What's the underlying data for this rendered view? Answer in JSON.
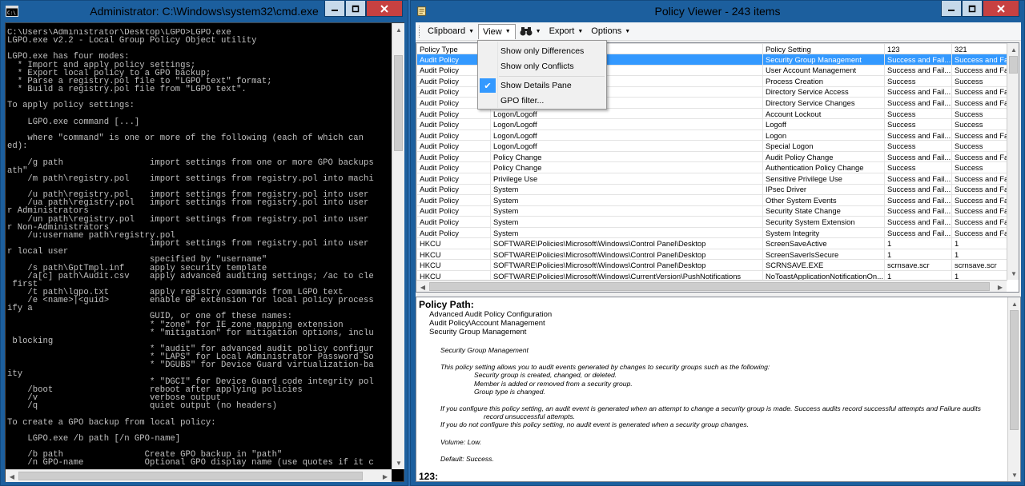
{
  "cmd": {
    "title": "Administrator: C:\\Windows\\system32\\cmd.exe",
    "lines": [
      "C:\\Users\\Administrator\\Desktop\\LGPO>LGPO.exe",
      "LGPO.exe v2.2 - Local Group Policy Object utility",
      "",
      "LGPO.exe has four modes:",
      "  * Import and apply policy settings;",
      "  * Export local policy to a GPO backup;",
      "  * Parse a registry.pol file to \"LGPO text\" format;",
      "  * Build a registry.pol file from \"LGPO text\".",
      "",
      "To apply policy settings:",
      "",
      "    LGPO.exe command [...]",
      "",
      "    where \"command\" is one or more of the following (each of which can",
      "ed):",
      "",
      "    /g path                 import settings from one or more GPO backups",
      "ath\"",
      "    /m path\\registry.pol    import settings from registry.pol into machi",
      "",
      "    /u path\\registry.pol    import settings from registry.pol into user",
      "    /ua path\\registry.pol   import settings from registry.pol into user",
      "r Administrators",
      "    /un path\\registry.pol   import settings from registry.pol into user",
      "r Non-Administrators",
      "    /u:username path\\registry.pol",
      "                            import settings from registry.pol into user",
      "r local user",
      "                            specified by \"username\"",
      "    /s path\\GptTmpl.inf     apply security template",
      "    /a[c] path\\Audit.csv    apply advanced auditing settings; /ac to cle",
      " first",
      "    /t path\\lgpo.txt        apply registry commands from LGPO text",
      "    /e <name>|<guid>        enable GP extension for local policy process",
      "ify a",
      "                            GUID, or one of these names:",
      "                            * \"zone\" for IE zone mapping extension",
      "                            * \"mitigation\" for mitigation options, inclu",
      " blocking",
      "                            * \"audit\" for advanced audit policy configur",
      "                            * \"LAPS\" for Local Administrator Password So",
      "                            * \"DGUBS\" for Device Guard virtualization-ba",
      "ity",
      "                            * \"DGCI\" for Device Guard code integrity pol",
      "    /boot                   reboot after applying policies",
      "    /v                      verbose output",
      "    /q                      quiet output (no headers)",
      "",
      "To create a GPO backup from local policy:",
      "",
      "    LGPO.exe /b path [/n GPO-name]",
      "",
      "    /b path                Create GPO backup in \"path\"",
      "    /n GPO-name            Optional GPO display name (use quotes if it c"
    ]
  },
  "pv": {
    "title": "Policy Viewer - 243 items",
    "toolbar": {
      "clipboard": "Clipboard",
      "view": "View",
      "export": "Export",
      "options": "Options"
    },
    "menu": {
      "items": [
        "Show only Differences",
        "Show only Conflicts",
        "Show Details Pane",
        "GPO filter..."
      ]
    },
    "grid": {
      "headers": [
        "Policy Type",
        "",
        "Policy Setting",
        "123",
        "321"
      ],
      "rows": [
        [
          "Audit Policy",
          "",
          "Security Group Management",
          "Success and Fail...",
          "Success and Fa"
        ],
        [
          "Audit Policy",
          "",
          "User Account Management",
          "Success and Fail...",
          "Success and Fa"
        ],
        [
          "Audit Policy",
          "",
          "Process Creation",
          "Success",
          "Success"
        ],
        [
          "Audit Policy",
          "",
          "Directory Service Access",
          "Success and Fail...",
          "Success and Fa"
        ],
        [
          "Audit Policy",
          "",
          "Directory Service Changes",
          "Success and Fail...",
          "Success and Fa"
        ],
        [
          "Audit Policy",
          "Logon/Logoff",
          "Account Lockout",
          "Success",
          "Success"
        ],
        [
          "Audit Policy",
          "Logon/Logoff",
          "Logoff",
          "Success",
          "Success"
        ],
        [
          "Audit Policy",
          "Logon/Logoff",
          "Logon",
          "Success and Fail...",
          "Success and Fa"
        ],
        [
          "Audit Policy",
          "Logon/Logoff",
          "Special Logon",
          "Success",
          "Success"
        ],
        [
          "Audit Policy",
          "Policy Change",
          "Audit Policy Change",
          "Success and Fail...",
          "Success and Fa"
        ],
        [
          "Audit Policy",
          "Policy Change",
          "Authentication Policy Change",
          "Success",
          "Success"
        ],
        [
          "Audit Policy",
          "Privilege Use",
          "Sensitive Privilege Use",
          "Success and Fail...",
          "Success and Fa"
        ],
        [
          "Audit Policy",
          "System",
          "IPsec Driver",
          "Success and Fail...",
          "Success and Fa"
        ],
        [
          "Audit Policy",
          "System",
          "Other System Events",
          "Success and Fail...",
          "Success and Fa"
        ],
        [
          "Audit Policy",
          "System",
          "Security State Change",
          "Success and Fail...",
          "Success and Fa"
        ],
        [
          "Audit Policy",
          "System",
          "Security System Extension",
          "Success and Fail...",
          "Success and Fa"
        ],
        [
          "Audit Policy",
          "System",
          "System Integrity",
          "Success and Fail...",
          "Success and Fa"
        ],
        [
          "HKCU",
          "SOFTWARE\\Policies\\Microsoft\\Windows\\Control Panel\\Desktop",
          "ScreenSaveActive",
          "1",
          "1"
        ],
        [
          "HKCU",
          "SOFTWARE\\Policies\\Microsoft\\Windows\\Control Panel\\Desktop",
          "ScreenSaverIsSecure",
          "1",
          "1"
        ],
        [
          "HKCU",
          "SOFTWARE\\Policies\\Microsoft\\Windows\\Control Panel\\Desktop",
          "SCRNSAVE.EXE",
          "scrnsave.scr",
          "scrnsave.scr"
        ],
        [
          "HKCU",
          "SOFTWARE\\Policies\\Microsoft\\Windows\\CurrentVersion\\PushNotifications",
          "NoToastApplicationNotificationOn...",
          "1",
          "1"
        ]
      ]
    },
    "details": {
      "heading": "Policy Path:",
      "path": [
        "Advanced Audit Policy Configuration",
        "Audit Policy\\Account Management",
        "Security Group Management"
      ],
      "name": "Security Group Management",
      "desc_intro": "This policy setting allows you to audit events generated by changes to security groups such as the following:",
      "desc_items": [
        "Security group is created, changed, or deleted.",
        "Member is added or removed from a security group.",
        "Group type is changed."
      ],
      "desc_config1": "If you configure this policy setting, an audit event is generated when an attempt to change a security group is made. Success audits record successful attempts and Failure audits",
      "desc_config1b": "record unsuccessful attempts.",
      "desc_config2": "If you do not configure this policy setting, no audit event is generated when a security group changes.",
      "volume": "Volume: Low.",
      "default": "Default: Success.",
      "next_heading": "123:"
    }
  }
}
